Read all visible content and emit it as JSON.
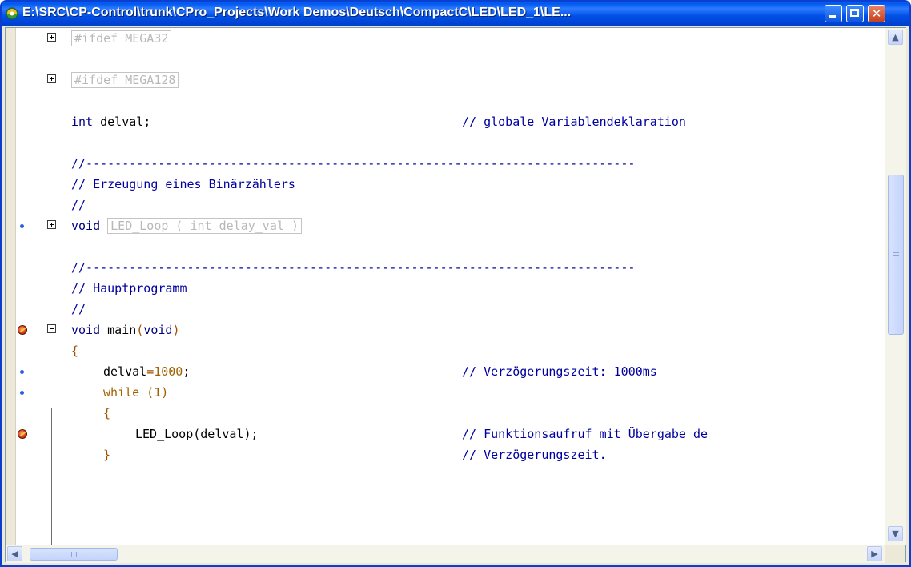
{
  "window": {
    "title": "E:\\SRC\\CP-Control\\trunk\\CPro_Projects\\Work Demos\\Deutsch\\CompactC\\LED\\LED_1\\LE...",
    "minimize_glyph": "",
    "close_glyph": "✕"
  },
  "code": {
    "l1_folded": "#ifdef MEGA32",
    "l2_folded": "#ifdef MEGA128",
    "l3_type": "int",
    "l3_rest": " delval;",
    "l3_comment": "// globale Variablendeklaration",
    "l4": "//----------------------------------------------------------------------------",
    "l5": "// Erzeugung eines Binärzählers",
    "l6": "//",
    "l7_kw": "void",
    "l7_folded": "LED_Loop ( int delay_val )",
    "l8": "//----------------------------------------------------------------------------",
    "l9": "// Hauptprogramm",
    "l10": "//",
    "l11_kw": "void",
    "l11_name": " main",
    "l11_p1": "(",
    "l11_arg": "void",
    "l11_p2": ")",
    "l12": "{",
    "l13_a": "delval",
    "l13_eq": "=",
    "l13_num": "1000",
    "l13_semi": ";",
    "l13_comment": "// Verzögerungszeit: 1000ms",
    "l14_kw": "while",
    "l14_rest": " (1)",
    "l15": "{",
    "l16_call": "LED_Loop",
    "l16_p": "(delval);",
    "l16_comment": "// Funktionsaufruf mit Übergabe de",
    "l17": "}",
    "l17_comment": "// Verzögerungszeit."
  },
  "colors": {
    "titlebar": "#0058ee",
    "keyword": "#000080",
    "comment": "#0000a0",
    "number": "#a06000"
  }
}
